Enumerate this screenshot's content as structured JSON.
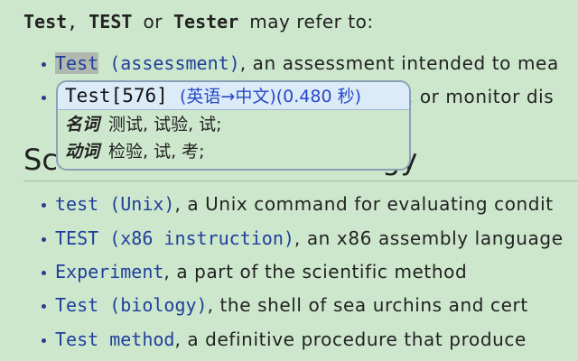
{
  "intro": {
    "terms": [
      "Test",
      "TEST",
      "Tester"
    ],
    "sep1": ",",
    "sep2": "or",
    "tail": "may refer to:"
  },
  "top_items": [
    {
      "link": "Test",
      "link2": "(assessment)",
      "desc": ", an assessment intended to mea"
    },
    {
      "link": "",
      "link2": "",
      "desc": "e, or monitor dis"
    }
  ],
  "heading": "Sc",
  "heading_tail": "gy",
  "items": [
    {
      "link": "test (Unix)",
      "desc": ", a Unix command for evaluating condit"
    },
    {
      "link": "TEST (x86 instruction)",
      "desc": ", an x86 assembly language"
    },
    {
      "link": "Experiment",
      "desc": ", a part of the scientific method"
    },
    {
      "link": "Test (biology)",
      "desc": ", the shell of sea urchins and cert"
    },
    {
      "link": "Test method",
      "desc": ", a definitive procedure that produce"
    }
  ],
  "popup": {
    "word": "Test[576]",
    "meta": "(英语→中文)(0.480 秒)",
    "rows": [
      {
        "pos": "名词",
        "meaning": "测试, 试验, 试;"
      },
      {
        "pos": "动词",
        "meaning": "检验, 试, 考;"
      }
    ]
  },
  "colors": {
    "background": "#cde7cd",
    "link": "#1f3f9a",
    "popup_border": "#8aa0b8",
    "popup_header": "#dcebf8",
    "popup_meta": "#2848c8"
  }
}
